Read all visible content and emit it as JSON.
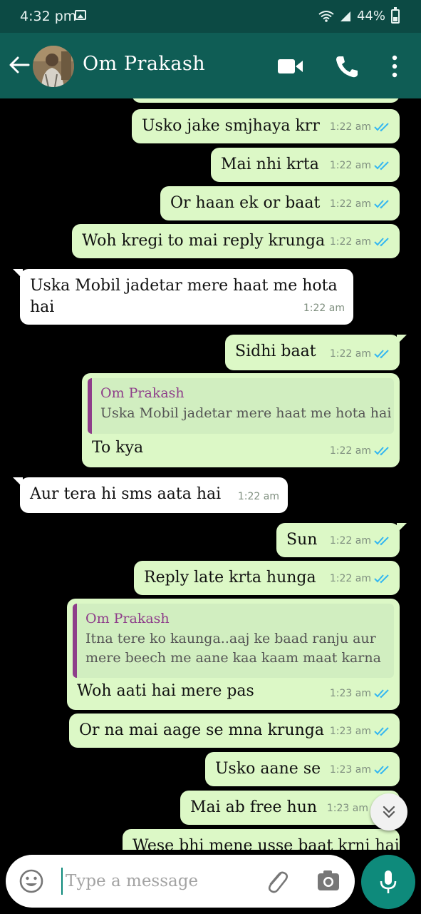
{
  "status_bar": {
    "time": "4:32 pm",
    "battery": "44%",
    "battery_level": 0.44
  },
  "header": {
    "contact_name": "Om Prakash"
  },
  "messages": [
    {
      "text": "Usko jake smjhaya krr",
      "time": "1:22 am"
    },
    {
      "text": "Mai nhi krta",
      "time": "1:22 am"
    },
    {
      "text": "Or haan ek or baat",
      "time": "1:22 am"
    },
    {
      "text": "Woh kregi to mai reply krunga",
      "time": "1:22 am"
    },
    {
      "text": "Uska Mobil jadetar mere haat me hota hai",
      "time": "1:22 am"
    },
    {
      "text": "Sidhi baat",
      "time": "1:22 am"
    },
    {
      "text": "To kya",
      "time": "1:22 am",
      "quote_name": "Om Prakash",
      "quote_text": "Uska Mobil jadetar mere haat me hota hai"
    },
    {
      "text": "Aur tera hi sms aata hai",
      "time": "1:22 am"
    },
    {
      "text": "Sun",
      "time": "1:22 am"
    },
    {
      "text": "Reply late krta hunga",
      "time": "1:22 am"
    },
    {
      "text": "Woh aati hai mere pas",
      "time": "1:23 am",
      "quote_name": "Om Prakash",
      "quote_text": "Itna tere ko kaunga..aaj ke baad ranju aur mere beech me aane kaa kaam maat karna"
    },
    {
      "text": "Or na mai aage se mna krunga",
      "time": "1:23 am"
    },
    {
      "text": "Usko aane se",
      "time": "1:23 am"
    },
    {
      "text": "Mai ab free hun",
      "time": "1:23 am"
    },
    {
      "text": "Wese bhi mene usse baat krni hai",
      "time": ""
    }
  ],
  "composer": {
    "placeholder": "Type a message"
  },
  "colors": {
    "header": "#0f5d55",
    "status_bar": "#0c4a44",
    "outgoing_bubble": "#dcf8c6",
    "incoming_bubble": "#ffffff",
    "read_ticks": "#34b7f1",
    "accent": "#0e8a7b"
  },
  "icons": [
    "back-arrow-icon",
    "video-call-icon",
    "phone-icon",
    "more-options-icon",
    "emoji-icon",
    "attach-icon",
    "camera-icon",
    "mic-icon",
    "double-chevron-down-icon",
    "read-ticks-icon"
  ]
}
